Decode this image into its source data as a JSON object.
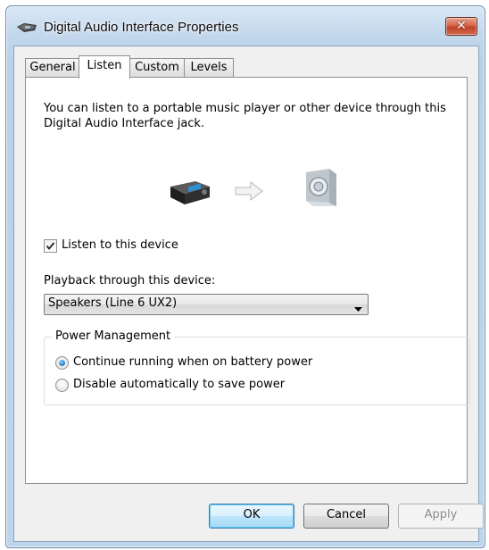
{
  "window": {
    "title": "Digital Audio Interface Properties",
    "close_glyph": "✕",
    "icon": "speaker-device-icon"
  },
  "tabs": [
    {
      "label": "General",
      "active": false
    },
    {
      "label": "Listen",
      "active": true
    },
    {
      "label": "Custom",
      "active": false
    },
    {
      "label": "Levels",
      "active": false
    }
  ],
  "listen": {
    "description": "You can listen to a portable music player or other device through this Digital Audio Interface jack.",
    "checkbox_label": "Listen to this device",
    "checkbox_checked": true,
    "playback_label": "Playback through this device:",
    "playback_value": "Speakers (Line 6 UX2)"
  },
  "power": {
    "legend": "Power Management",
    "options": [
      {
        "label": "Continue running when on battery power",
        "selected": true
      },
      {
        "label": "Disable automatically to save power",
        "selected": false
      }
    ]
  },
  "buttons": {
    "ok": "OK",
    "cancel": "Cancel",
    "apply": "Apply"
  },
  "colors": {
    "accent": "#1c76c8",
    "close_button": "#c2412a",
    "window_frame": "#b9d1e8"
  }
}
